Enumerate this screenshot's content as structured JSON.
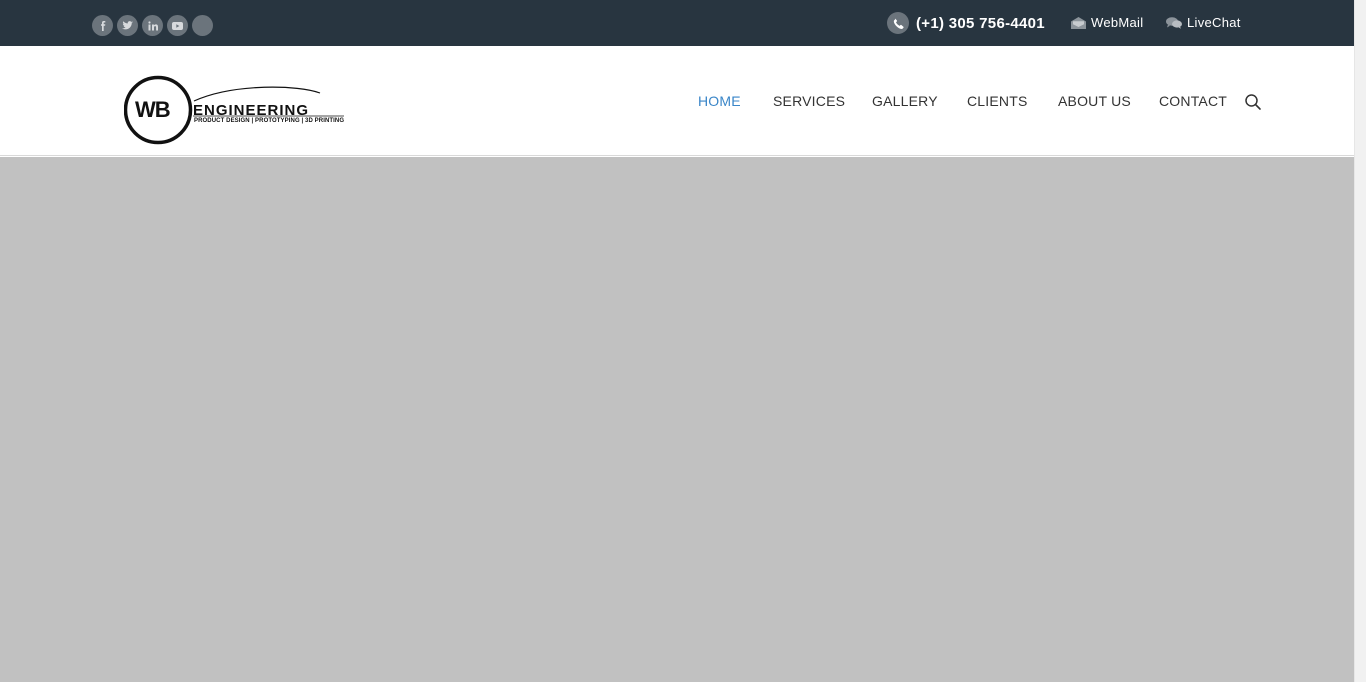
{
  "topbar": {
    "social": [
      {
        "icon": "facebook-icon"
      },
      {
        "icon": "twitter-icon"
      },
      {
        "icon": "linkedin-icon"
      },
      {
        "icon": "youtube-icon"
      },
      {
        "icon": "blank-social-icon"
      }
    ],
    "phone": "(+1) 305 756-4401",
    "webmail_label": "WebMail",
    "livechat_label": "LiveChat"
  },
  "header": {
    "logo": {
      "brand": "WB ENGINEERING",
      "tagline": "PRODUCT DESIGN | PROTOTYPING | 3D PRINTING"
    },
    "nav": [
      {
        "label": "HOME",
        "active": true
      },
      {
        "label": "SERVICES",
        "active": false
      },
      {
        "label": "GALLERY",
        "active": false
      },
      {
        "label": "CLIENTS",
        "active": false
      },
      {
        "label": "ABOUT US",
        "active": false
      },
      {
        "label": "CONTACT",
        "active": false
      }
    ]
  },
  "colors": {
    "topbar_bg": "#283540",
    "accent": "#3a86c8",
    "hero_bg": "#c1c1c1"
  }
}
